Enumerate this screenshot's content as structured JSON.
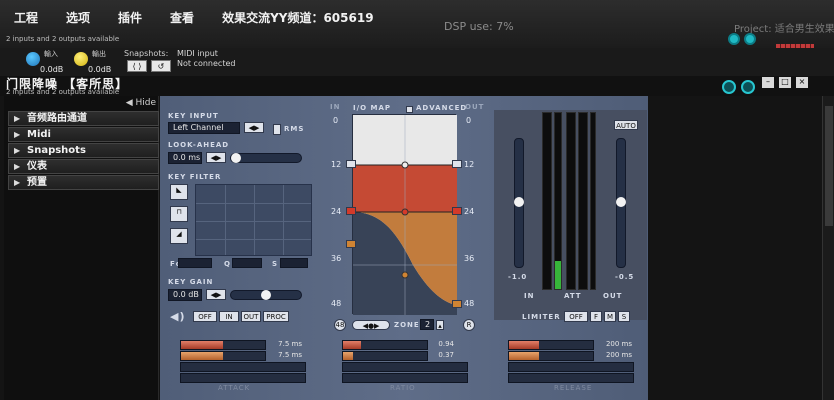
{
  "menu": {
    "items": [
      "工程",
      "选项",
      "插件",
      "查看"
    ],
    "title": "效果交流YY频道：605619",
    "dsp_use": "DSP use: 7%",
    "project": "Project: 适合男生效果"
  },
  "io": {
    "channels_line_top": "2 inputs and 2 outputs available",
    "input_label": "輸入",
    "output_label": "輸出",
    "input_value": "0.0dB",
    "output_value": "0.0dB",
    "snapshots_label": "Snapshots:",
    "midi_label": "MIDI input",
    "midi_status": "Not connected"
  },
  "plugin": {
    "title": "门限降噪 【客所思】",
    "subtitle": "2 inputs and 2 outputs available"
  },
  "sidebar": {
    "hide_label": "◀ Hide",
    "items": [
      {
        "label": "音频路由通道"
      },
      {
        "label": "Midi"
      },
      {
        "label": "Snapshots"
      },
      {
        "label": "仪表"
      },
      {
        "label": "预置"
      }
    ]
  },
  "gate": {
    "key_input_label": "KEY INPUT",
    "key_input_value": "Left Channel",
    "rms_label": "RMS",
    "look_ahead_label": "LOOK-AHEAD",
    "look_ahead_value": "0.0 ms",
    "key_filter_label": "KEY FILTER",
    "fc_label": "Fc",
    "q_label": "Q",
    "s_label": "S",
    "key_gain_label": "KEY GAIN",
    "key_gain_value": "0.0 dB",
    "buttons": [
      "OFF",
      "IN",
      "OUT",
      "PROC"
    ],
    "iomap_label": "I/O MAP",
    "advanced_label": "ADVANCED",
    "in_label": "IN",
    "out_label": "OUT",
    "scale": [
      "0",
      "12",
      "24",
      "36",
      "48"
    ],
    "zones_label": "ZONES",
    "zones_value": "2",
    "limiter_label": "LIMITER",
    "limiter_buttons": [
      "OFF",
      "F",
      "M",
      "S"
    ],
    "auto_label": "AUTO",
    "meter_left_value": "-1.0",
    "meter_right_value": "-0.5",
    "meter_in": "IN",
    "meter_att": "ATT",
    "meter_out": "OUT",
    "attack_values": [
      "7.5 ms",
      "7.5 ms"
    ],
    "ratio_values": [
      "0.94",
      "0.37"
    ],
    "release_values": [
      "200 ms",
      "200 ms"
    ],
    "attack_label": "ATTACK",
    "ratio_label": "RATIO",
    "release_label": "RELEASE"
  }
}
